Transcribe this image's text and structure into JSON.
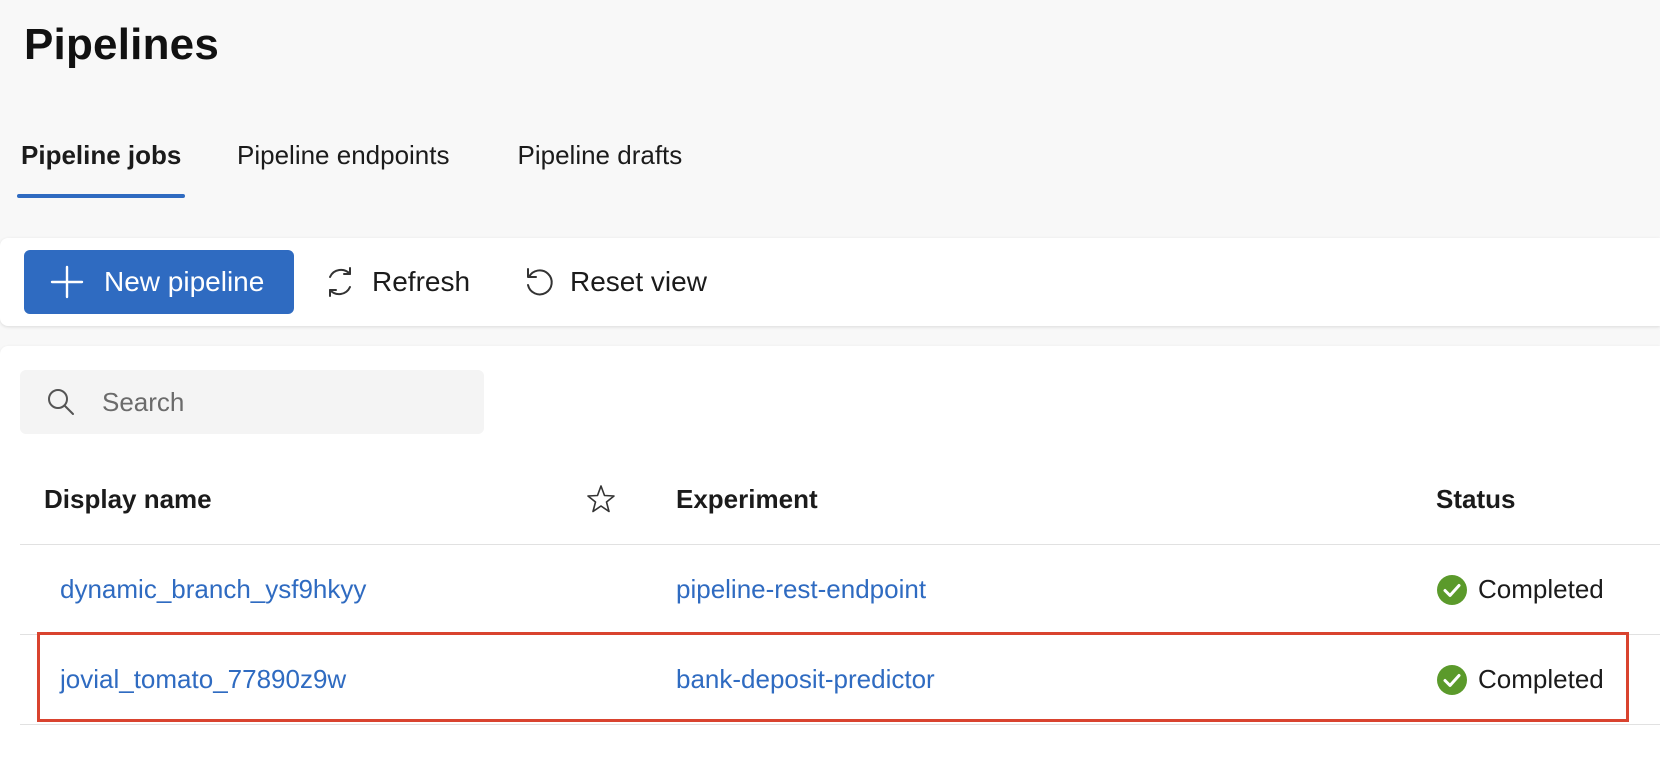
{
  "page": {
    "title": "Pipelines"
  },
  "tabs": [
    {
      "label": "Pipeline jobs",
      "active": true
    },
    {
      "label": "Pipeline endpoints",
      "active": false
    },
    {
      "label": "Pipeline drafts",
      "active": false
    }
  ],
  "toolbar": {
    "new_pipeline_label": "New pipeline",
    "refresh_label": "Refresh",
    "reset_view_label": "Reset view"
  },
  "search": {
    "placeholder": "Search",
    "value": ""
  },
  "table": {
    "columns": {
      "display_name": "Display name",
      "experiment": "Experiment",
      "status": "Status"
    },
    "rows": [
      {
        "display_name": "dynamic_branch_ysf9hkyy",
        "experiment": "pipeline-rest-endpoint",
        "status": "Completed"
      },
      {
        "display_name": "jovial_tomato_77890z9w",
        "experiment": "bank-deposit-predictor",
        "status": "Completed"
      }
    ]
  },
  "colors": {
    "accent": "#2f6bc1",
    "status_completed": "#5b9a2b",
    "highlight_border": "#d9432f"
  },
  "icons": {
    "new_pipeline": "plus-icon",
    "refresh": "refresh-icon",
    "reset_view": "reset-icon",
    "search": "search-icon",
    "favorite_column": "star-icon",
    "status_completed": "check-circle-icon"
  }
}
